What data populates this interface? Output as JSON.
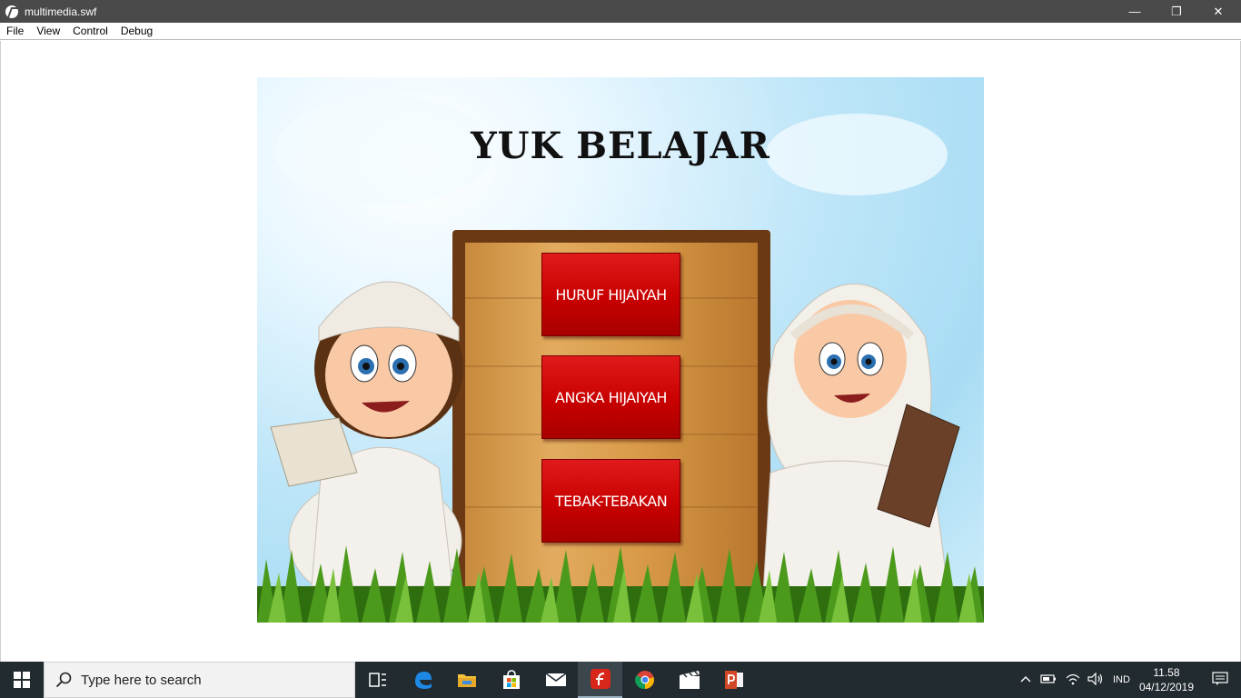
{
  "window": {
    "title": "multimedia.swf",
    "controls": {
      "minimize": "—",
      "restore": "❐",
      "close": "✕"
    }
  },
  "menu": [
    "File",
    "View",
    "Control",
    "Debug"
  ],
  "stage": {
    "title": "YUK BELAJAR",
    "buttons": [
      "HURUF HIJAIYAH",
      "ANGKA HIJAIYAH",
      "TEBAK-TEBAKAN"
    ],
    "colors": {
      "button": "#c80000",
      "board": "#d89a48",
      "sky": "#a8dcf4",
      "grass": "#3f8a16"
    }
  },
  "taskbar": {
    "search_placeholder": "Type here to search",
    "apps": [
      "task-view-icon",
      "edge-icon",
      "file-explorer-icon",
      "store-icon",
      "mail-icon",
      "flash-icon",
      "chrome-icon",
      "movie-maker-icon",
      "powerpoint-icon"
    ],
    "tray": {
      "language": "IND",
      "time": "11.58",
      "date": "04/12/2019"
    }
  }
}
